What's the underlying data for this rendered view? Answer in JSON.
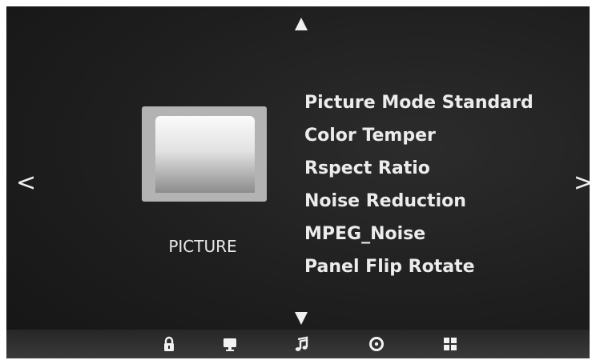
{
  "category": {
    "label": "PICTURE",
    "icon": "picture-preview-icon"
  },
  "menu": {
    "items": [
      {
        "label": "Picture Mode Standard"
      },
      {
        "label": "Color Temper"
      },
      {
        "label": "Rspect Ratio"
      },
      {
        "label": "Noise Reduction"
      },
      {
        "label": "MPEG_Noise"
      },
      {
        "label": "Panel Flip Rotate"
      }
    ]
  },
  "navigation": {
    "prev_glyph": "<",
    "next_glyph": ">"
  },
  "bottom_bar": {
    "icons": [
      "lock-icon",
      "monitor-icon",
      "music-note-icon",
      "clock-icon",
      "apps-grid-icon"
    ]
  }
}
